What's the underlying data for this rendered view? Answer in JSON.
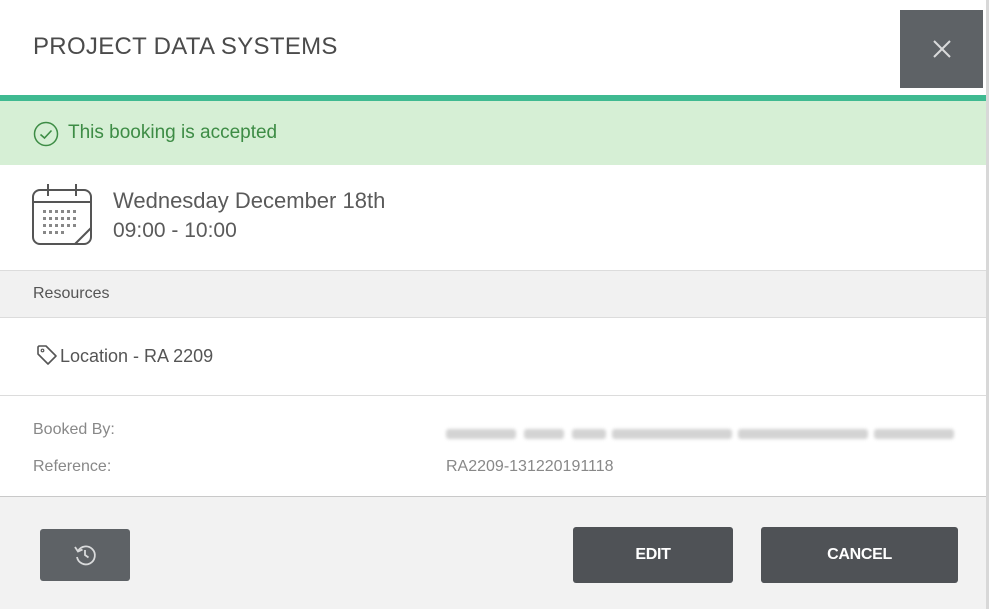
{
  "header": {
    "title": "PROJECT DATA SYSTEMS",
    "close_icon": "close-icon"
  },
  "status": {
    "text": "This booking is accepted",
    "icon": "check-circle-icon",
    "color": "#3d8c45",
    "background": "#d6efd5",
    "accent": "#3fba91"
  },
  "booking": {
    "date": "Wednesday December 18th",
    "time": "09:00 - 10:00",
    "icon": "calendar-icon"
  },
  "resources": {
    "heading": "Resources",
    "items": [
      {
        "label": "Location - RA 2209",
        "icon": "tag-icon"
      }
    ]
  },
  "details": {
    "booked_by_label": "Booked By:",
    "reference_label": "Reference:",
    "reference_value": "RA2209-131220191118"
  },
  "footer": {
    "history_icon": "history-icon",
    "edit_label": "EDIT",
    "cancel_label": "CANCEL",
    "button_color": "#4f5256"
  }
}
